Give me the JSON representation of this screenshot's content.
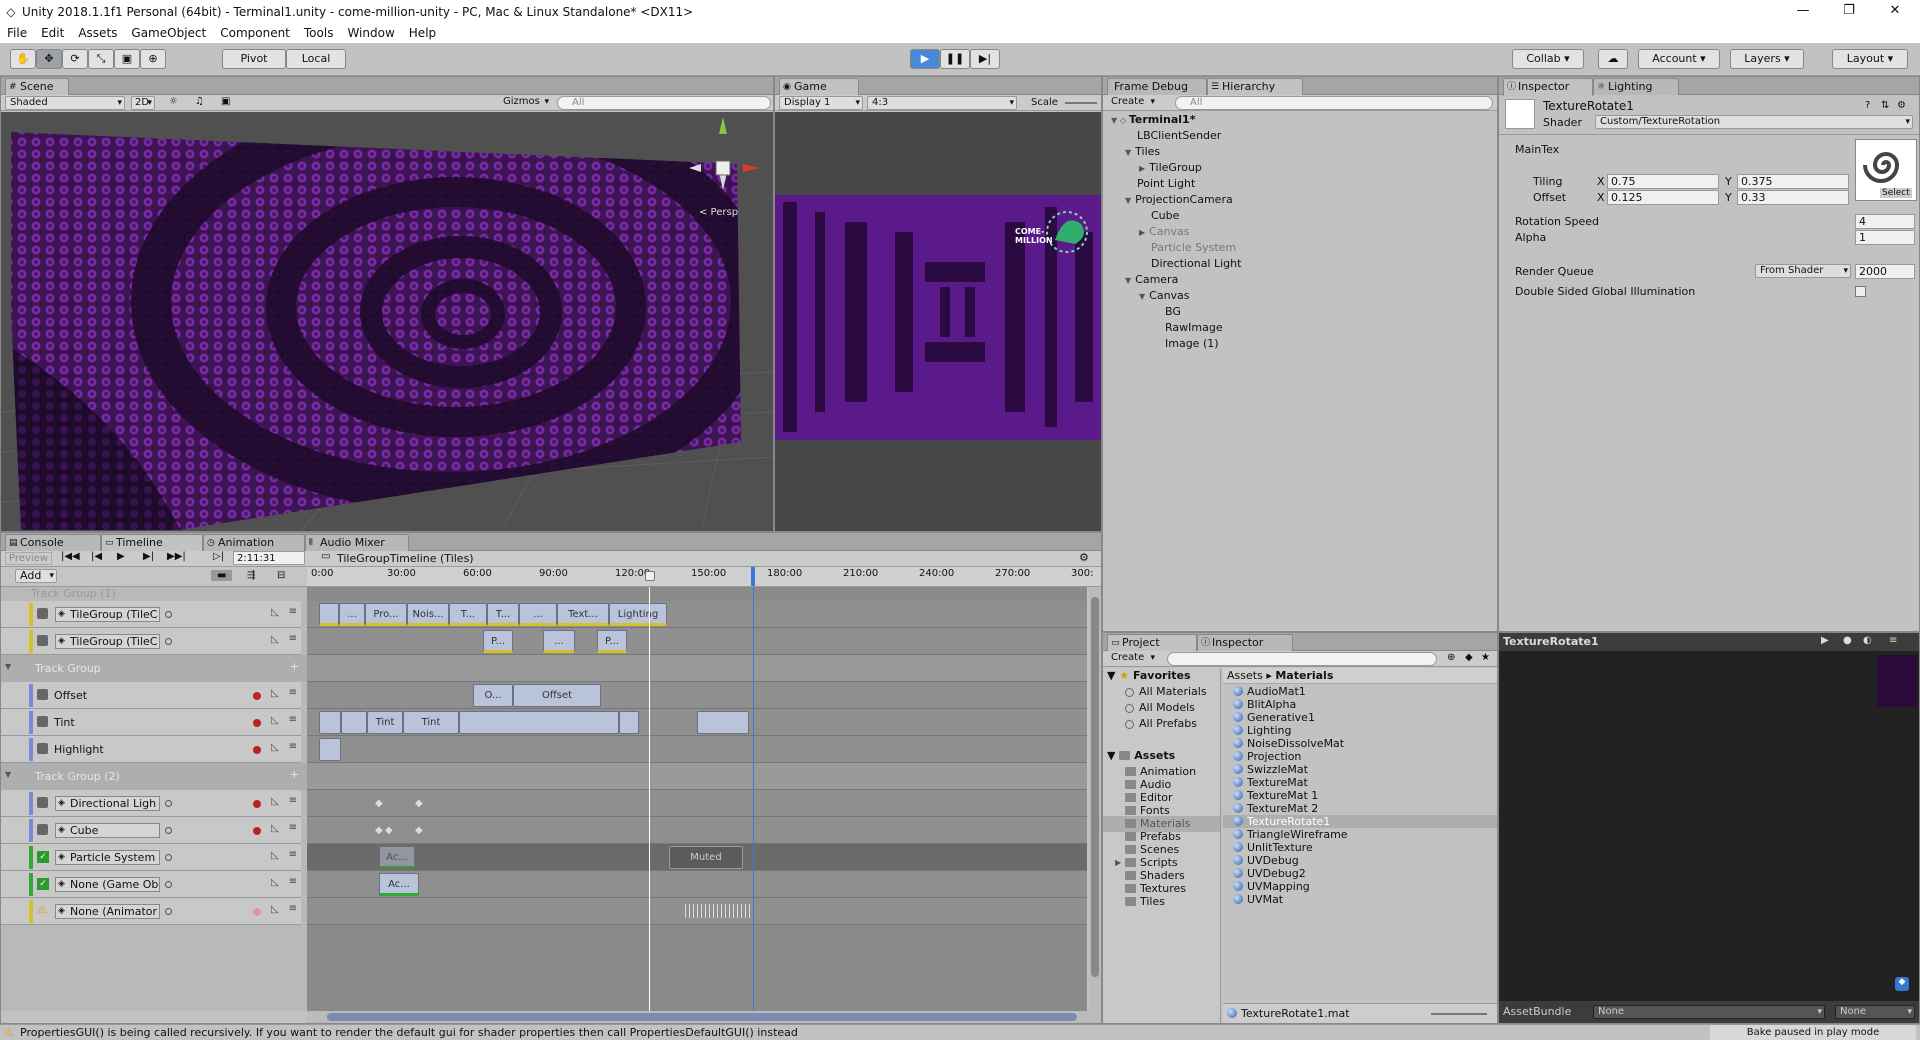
{
  "window": {
    "title": "Unity 2018.1.1f1 Personal (64bit) - Terminal1.unity - come-million-unity - PC, Mac & Linux Standalone* <DX11>",
    "minimize_icon": "minimize-icon",
    "maximize_icon": "maximize-icon",
    "close_icon": "close-icon"
  },
  "menu": [
    "File",
    "Edit",
    "Assets",
    "GameObject",
    "Component",
    "Tools",
    "Window",
    "Help"
  ],
  "toolbar": {
    "pivot": "Pivot",
    "local": "Local",
    "collab": "Collab",
    "account": "Account",
    "layers": "Layers",
    "layout": "Layout"
  },
  "scene": {
    "tab": "Scene",
    "shading": "Shaded",
    "mode2d": "2D",
    "gizmos": "Gizmos",
    "search": "All",
    "persp": "< Persp"
  },
  "game": {
    "tab": "Game",
    "display": "Display 1",
    "aspect": "4:3",
    "scale": "Scale",
    "logo_text": [
      "COME-",
      "MILLION"
    ]
  },
  "hierarchy": {
    "tabs": [
      "Frame Debug",
      "Hierarchy"
    ],
    "create": "Create",
    "search": "All",
    "scene_name": "Terminal1*",
    "items": [
      {
        "label": "LBClientSender",
        "indent": 1,
        "arrow": "",
        "dim": false
      },
      {
        "label": "Tiles",
        "indent": 1,
        "arrow": "▼",
        "dim": false
      },
      {
        "label": "TileGroup",
        "indent": 2,
        "arrow": "▶",
        "dim": false
      },
      {
        "label": "Point Light",
        "indent": 1,
        "arrow": "",
        "dim": false
      },
      {
        "label": "ProjectionCamera",
        "indent": 1,
        "arrow": "▼",
        "dim": false
      },
      {
        "label": "Cube",
        "indent": 2,
        "arrow": "",
        "dim": false
      },
      {
        "label": "Canvas",
        "indent": 2,
        "arrow": "▶",
        "dim": true
      },
      {
        "label": "Particle System",
        "indent": 2,
        "arrow": "",
        "dim": true
      },
      {
        "label": "Directional Light",
        "indent": 2,
        "arrow": "",
        "dim": false
      },
      {
        "label": "Camera",
        "indent": 1,
        "arrow": "▼",
        "dim": false
      },
      {
        "label": "Canvas",
        "indent": 2,
        "arrow": "▼",
        "dim": false
      },
      {
        "label": "BG",
        "indent": 3,
        "arrow": "",
        "dim": false
      },
      {
        "label": "RawImage",
        "indent": 3,
        "arrow": "",
        "dim": false
      },
      {
        "label": "Image (1)",
        "indent": 3,
        "arrow": "",
        "dim": false
      }
    ]
  },
  "inspector": {
    "tabs": [
      "Inspector",
      "Lighting"
    ],
    "material_name": "TextureRotate1",
    "shader_label": "Shader",
    "shader_value": "Custom/TextureRotation",
    "maintex": "MainTex",
    "tiling": "Tiling",
    "offset": "Offset",
    "x": "X",
    "y": "Y",
    "tiling_x": "0.75",
    "tiling_y": "0.375",
    "offset_x": "0.125",
    "offset_y": "0.33",
    "select": "Select",
    "rotation_speed_label": "Rotation Speed",
    "rotation_speed": "4",
    "alpha_label": "Alpha",
    "alpha": "1",
    "render_queue_label": "Render Queue",
    "render_queue_mode": "From Shader",
    "render_queue": "2000",
    "dsgi_label": "Double Sided Global Illumination"
  },
  "preview": {
    "title": "TextureRotate1",
    "assetbundle_label": "AssetBundle",
    "assetbundle_value": "None",
    "assetbundle_variant": "None"
  },
  "bottom_tabs": [
    "Console",
    "Timeline",
    "Animation",
    "Audio Mixer"
  ],
  "timeline": {
    "preview": "Preview",
    "time": "2:11:31",
    "asset": "TileGroupTimeline (Tiles)",
    "add": "Add",
    "ruler": [
      "0:00",
      "30:00",
      "60:00",
      "90:00",
      "120:00",
      "150:00",
      "180:00",
      "210:00",
      "240:00",
      "270:00",
      "300:"
    ],
    "top_group_label": "Track Group (1)",
    "tracks": [
      {
        "label": "TileGroup (TileC",
        "type": "field",
        "color": "#d6c228"
      },
      {
        "label": "TileGroup (TileC",
        "type": "field",
        "color": "#d6c228"
      },
      {
        "label": "Track Group",
        "type": "group"
      },
      {
        "label": "Offset",
        "type": "plain",
        "color": "#7b8ad6",
        "rec": true
      },
      {
        "label": "Tint",
        "type": "plain",
        "color": "#7b8ad6",
        "rec": true
      },
      {
        "label": "Highlight",
        "type": "plain",
        "color": "#7b8ad6",
        "rec": true
      },
      {
        "label": "Track Group (2)",
        "type": "group"
      },
      {
        "label": "Directional Ligh",
        "type": "field",
        "color": "#7b8ad6",
        "rec": true
      },
      {
        "label": "Cube",
        "type": "field",
        "color": "#7b8ad6",
        "rec": true
      },
      {
        "label": "Particle System",
        "type": "field",
        "color": "#2faa34",
        "check": true
      },
      {
        "label": "None (Game Ob",
        "type": "field",
        "color": "#2faa34",
        "check": true
      },
      {
        "label": "None (Animator",
        "type": "field",
        "color": "#d6c228",
        "warn": true,
        "rec": true
      }
    ],
    "clips_row0": [
      "...",
      "Pro...",
      "Nois...",
      "T...",
      "T...",
      "...",
      "Text...",
      "Lighting"
    ],
    "clips_row1": [
      "P...",
      "...",
      "P..."
    ],
    "clips_offset": [
      "O...",
      "Offset"
    ],
    "clips_tint": [
      "Tint",
      "Tint"
    ],
    "clip_active": "Ac...",
    "muted": "Muted"
  },
  "project": {
    "tabs": [
      "Project",
      "Inspector"
    ],
    "create": "Create",
    "favorites": "Favorites",
    "fav_items": [
      "All Materials",
      "All Models",
      "All Prefabs"
    ],
    "assets": "Assets",
    "folders": [
      "Animation",
      "Audio",
      "Editor",
      "Fonts",
      "Materials",
      "Prefabs",
      "Scenes",
      "Scripts",
      "Shaders",
      "Textures",
      "Tiles"
    ],
    "breadcrumb": [
      "Assets",
      "Materials"
    ],
    "materials": [
      "AudioMat1",
      "BlitAlpha",
      "Generative1",
      "Lighting",
      "NoiseDissolveMat",
      "Projection",
      "SwizzleMat",
      "TextureMat",
      "TextureMat 1",
      "TextureMat 2",
      "TextureRotate1",
      "TriangleWireframe",
      "UnlitTexture",
      "UVDebug",
      "UVDebug2",
      "UVMapping",
      "UVMat"
    ],
    "selected_file": "TextureRotate1.mat"
  },
  "status": {
    "message": "PropertiesGUI() is being called recursively. If you want to render the default gui for shader properties then call PropertiesDefaultGUI() instead",
    "bake": "Bake paused in play mode"
  }
}
